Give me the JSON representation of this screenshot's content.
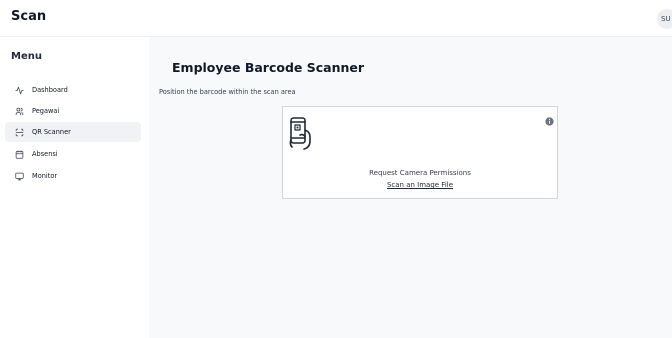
{
  "app": {
    "title": "Scan",
    "user_initials": "SU"
  },
  "sidebar": {
    "menu_title": "Menu",
    "items": [
      {
        "label": "Dashboard",
        "icon": "activity-icon",
        "active": false
      },
      {
        "label": "Pegawai",
        "icon": "users-icon",
        "active": false
      },
      {
        "label": "QR Scanner",
        "icon": "scan-icon",
        "active": true
      },
      {
        "label": "Absensi",
        "icon": "calendar-icon",
        "active": false
      },
      {
        "label": "Monitor",
        "icon": "monitor-icon",
        "active": false
      }
    ]
  },
  "main": {
    "title": "Employee Barcode Scanner",
    "subtitle": "Position the barcode within the scan area"
  },
  "scanner": {
    "request_text": "Request Camera Permissions",
    "scan_file_link": "Scan an Image File",
    "info_icon": "info-icon",
    "camera_icon": "phone-scan-icon"
  },
  "colors": {
    "active_nav_bg": "#f0f2f5",
    "main_bg": "#f8f9fb",
    "border": "#d1d5db"
  }
}
